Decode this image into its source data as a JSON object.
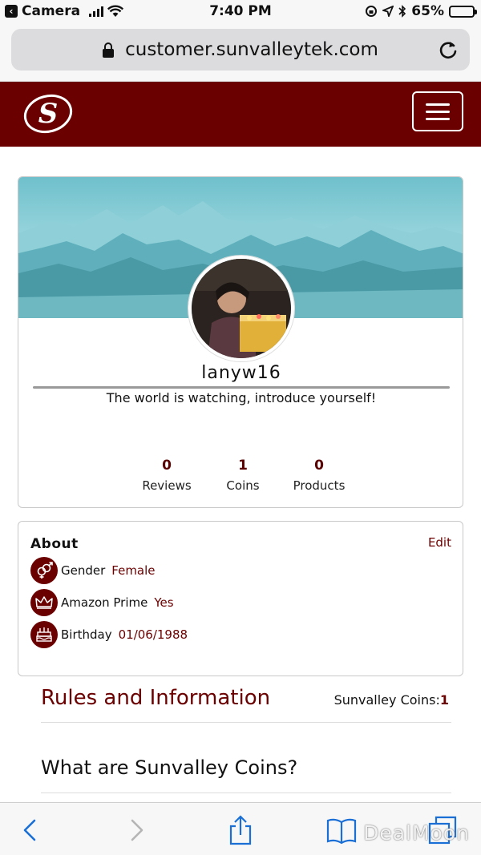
{
  "status_bar": {
    "back_app": "Camera",
    "time": "7:40 PM",
    "battery": "65%",
    "battery_level": 0.65
  },
  "browser": {
    "url": "customer.sunvalleytek.com"
  },
  "profile": {
    "username": "lanyw16",
    "tagline": "The world is watching, introduce yourself!",
    "stats": [
      {
        "value": "0",
        "label": "Reviews"
      },
      {
        "value": "1",
        "label": "Coins"
      },
      {
        "value": "0",
        "label": "Products"
      }
    ]
  },
  "about": {
    "title": "About",
    "edit_label": "Edit",
    "rows": [
      {
        "key": "Gender",
        "value": "Female",
        "icon": "gender-icon"
      },
      {
        "key": "Amazon Prime",
        "value": "Yes",
        "icon": "crown-icon"
      },
      {
        "key": "Birthday",
        "value": "01/06/1988",
        "icon": "cake-icon"
      }
    ]
  },
  "rules": {
    "title": "Rules and Information",
    "coins_label": "Sunvalley Coins:",
    "coins_value": "1",
    "question": "What are Sunvalley Coins?"
  },
  "watermark": "DealMoon",
  "colors": {
    "brand": "#6b0000",
    "banner_sky": "#7fc8d2",
    "banner_mountain": "#4a9aa6"
  }
}
